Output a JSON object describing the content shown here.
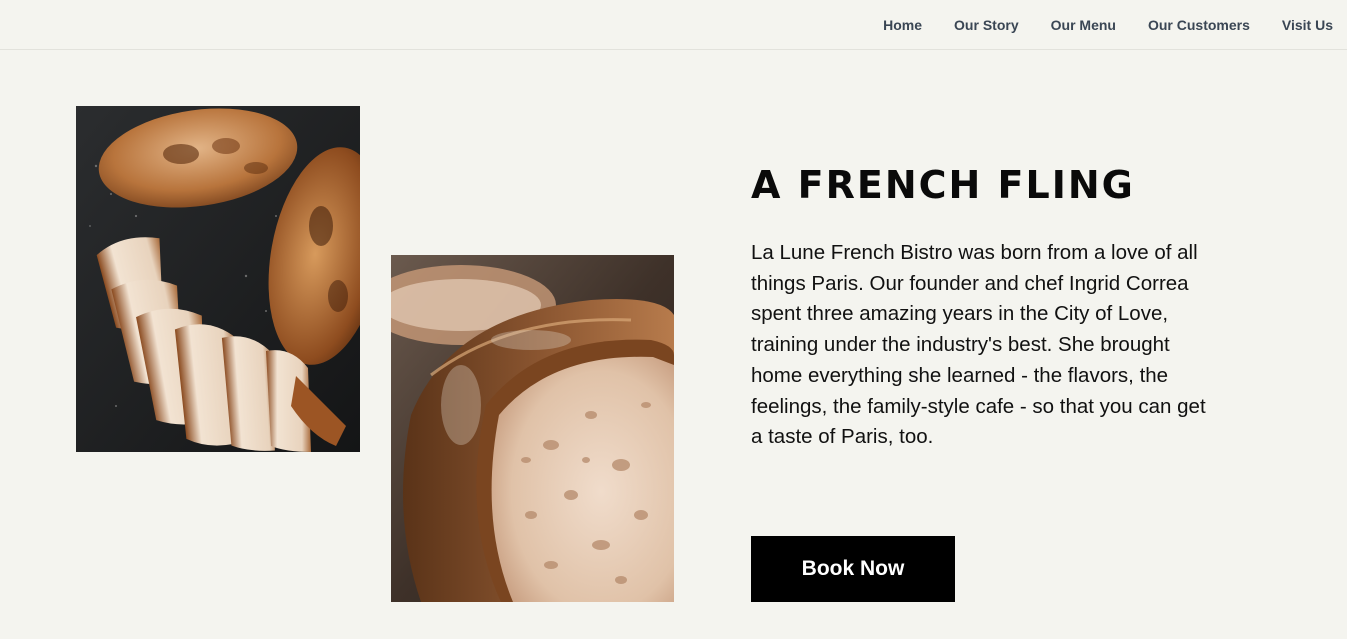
{
  "nav": {
    "items": [
      {
        "label": "Home"
      },
      {
        "label": "Our Story"
      },
      {
        "label": "Our Menu"
      },
      {
        "label": "Our Customers"
      },
      {
        "label": "Visit Us"
      }
    ]
  },
  "story": {
    "title": "A FRENCH FLING",
    "body": "La Lune French Bistro was born from a love of all things Paris. Our founder and chef Ingrid Correa spent three amazing years in the City of Love, training under the industry's best. She brought home everything she learned - the flavors, the feelings, the family-style cafe - so that you can get a taste of Paris, too.",
    "button_label": "Book Now"
  },
  "colors": {
    "background": "#f4f4ef",
    "nav_text": "#3a4654",
    "button_bg": "#000000",
    "button_text": "#ffffff"
  }
}
